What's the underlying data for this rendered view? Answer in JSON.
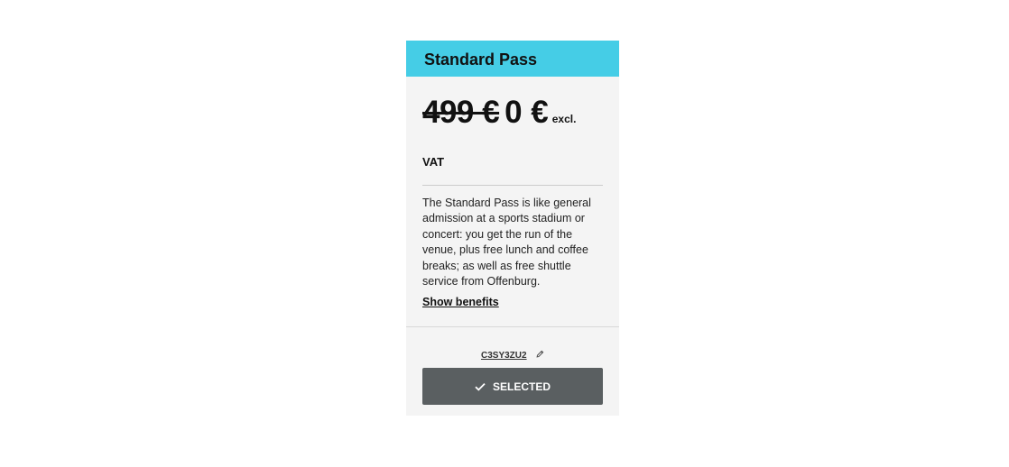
{
  "card": {
    "title": "Standard Pass",
    "price": {
      "original": "499 €",
      "current": "0 €",
      "excl_label": "excl.",
      "vat_label": "VAT"
    },
    "description": "The Standard Pass is like general admission at a sports stadium or concert: you get the run of the venue, plus free lunch and coffee breaks; as well as free shuttle service from Offenburg.",
    "show_benefits_label": "Show benefits",
    "promo_code": "C3SY3ZU2",
    "selected_button_label": "SELECTED",
    "selected": true
  },
  "colors": {
    "header_bg": "#45cde6",
    "card_bg": "#f4f4f4",
    "button_bg": "#5a5f61",
    "button_text": "#ffffff"
  },
  "icons": {
    "edit": "pencil-icon",
    "selected": "check-icon"
  }
}
